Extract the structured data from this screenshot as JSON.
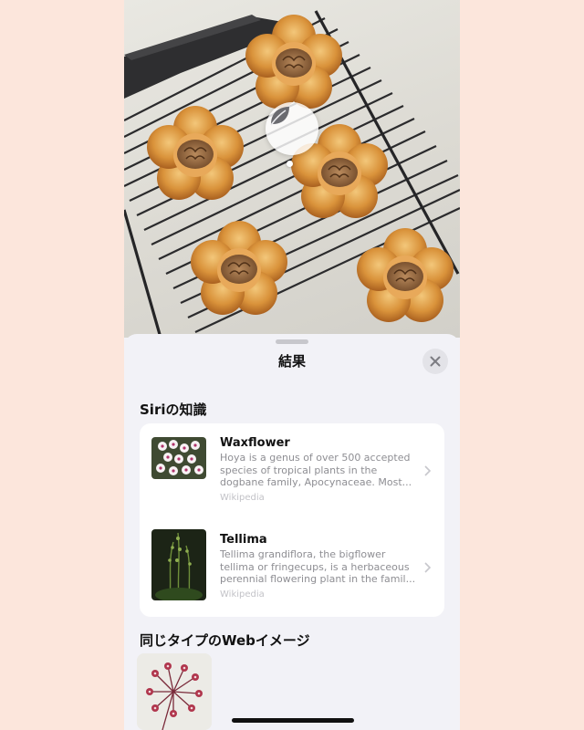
{
  "sheet": {
    "title": "結果",
    "close_icon": "xmark-icon"
  },
  "photo": {
    "lookup_icon": "leaf-icon"
  },
  "siri_knowledge": {
    "heading": "Siriの知識",
    "items": [
      {
        "title": "Waxflower",
        "description": "Hoya is a genus of over 500 accepted species of tropical plants in the dogbane family, Apocynaceae. Most...",
        "source": "Wikipedia",
        "thumbnail": "waxflower-photo"
      },
      {
        "title": "Tellima",
        "description": "Tellima grandiflora, the bigflower tellima or fringecups, is a herbaceous perennial flowering plant in the famil...",
        "source": "Wikipedia",
        "thumbnail": "tellima-photo"
      }
    ]
  },
  "web_images": {
    "heading": "同じタイプのWebイメージ",
    "thumbnail": "hoya-flower-photo"
  },
  "colors": {
    "page_background": "#fce6dc",
    "sheet_background": "#f2f2f7",
    "card_background": "#ffffff",
    "secondary_text": "#8e8e93"
  }
}
